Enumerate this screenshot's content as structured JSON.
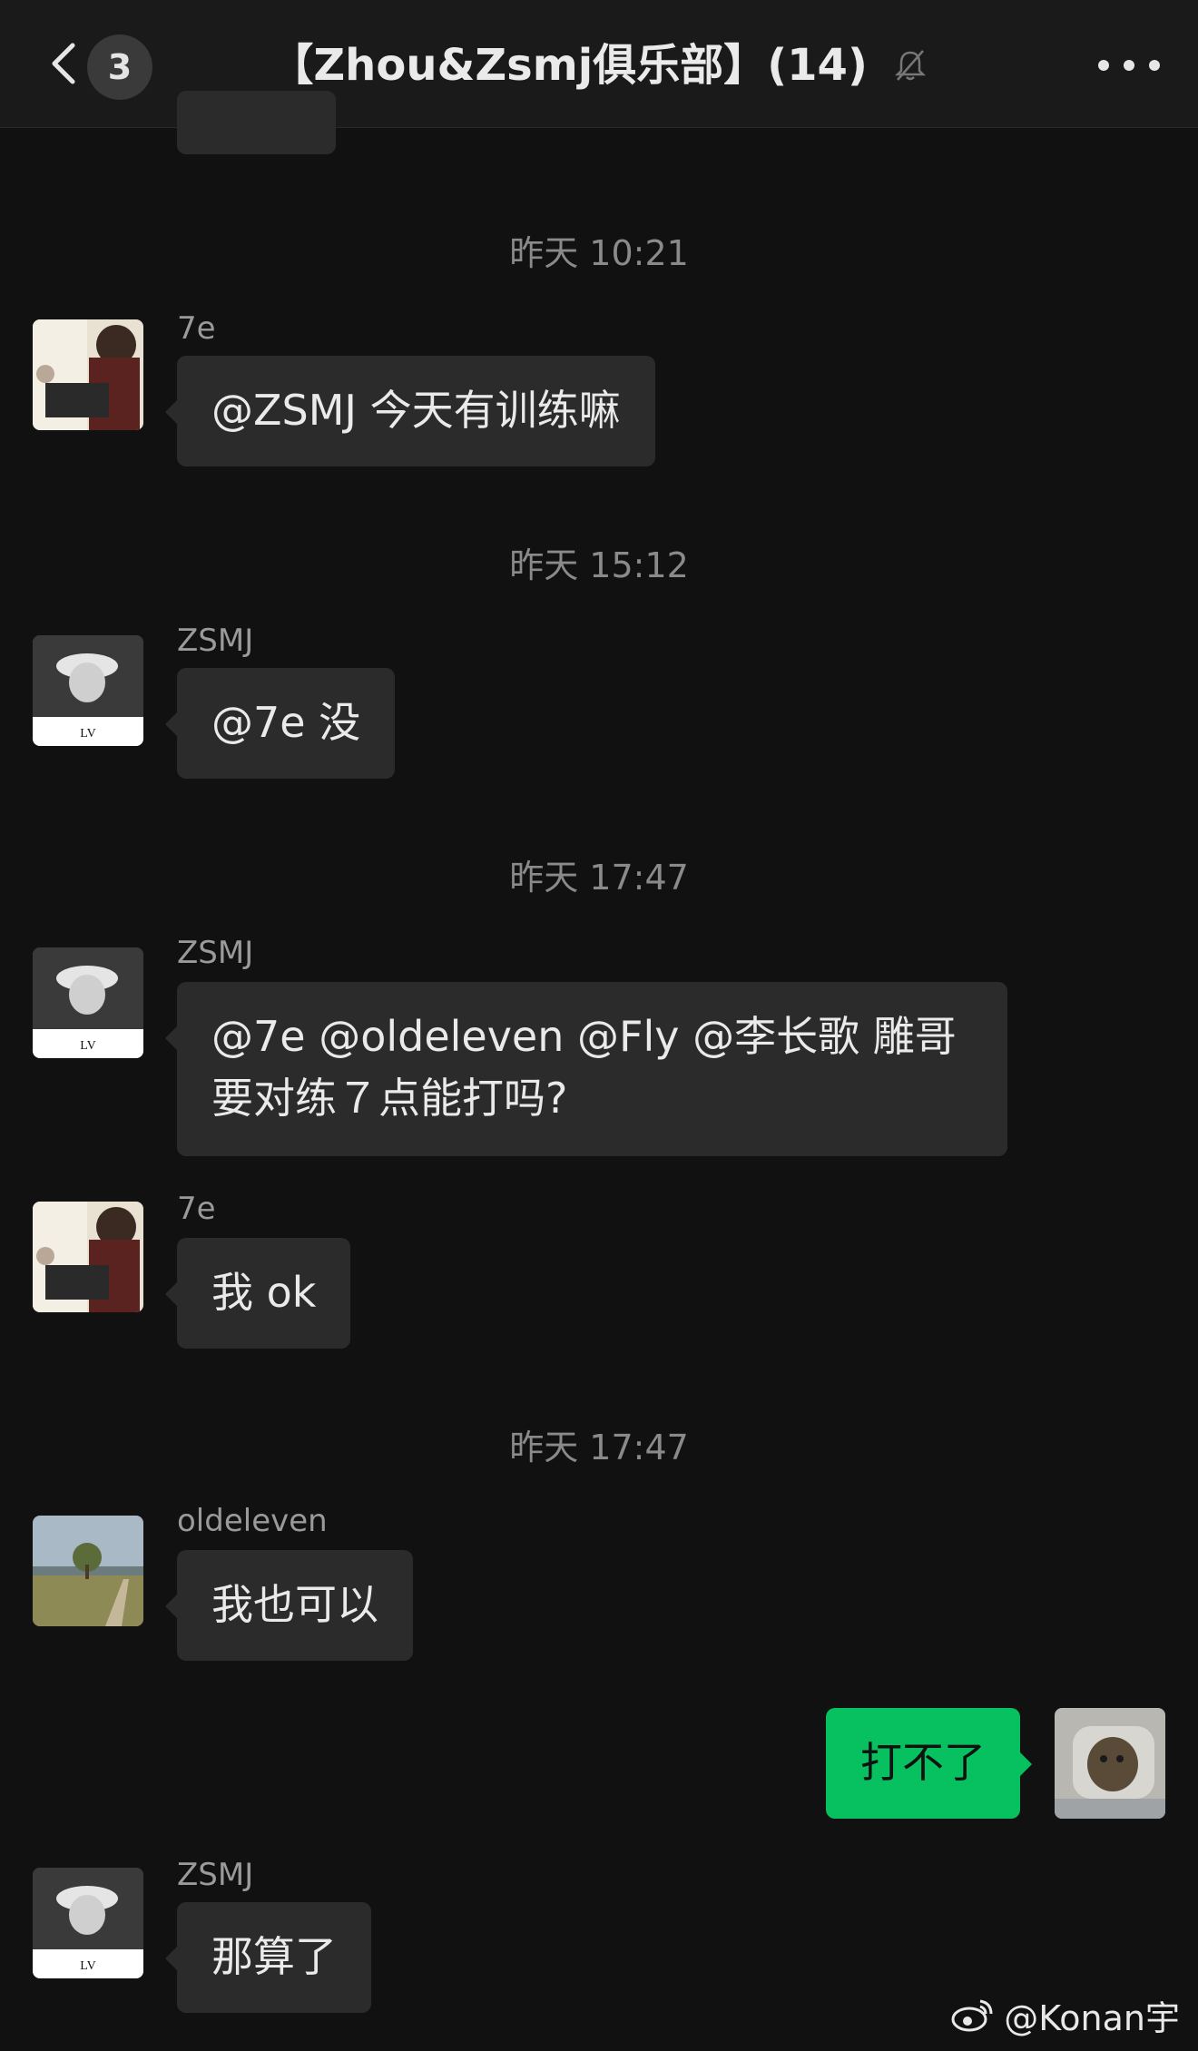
{
  "header": {
    "unread_count": "3",
    "title": "【Zhou&Zsmj俱乐部】(14)"
  },
  "messages": [
    {
      "type": "time",
      "text": "昨天 10:21"
    },
    {
      "type": "msg",
      "sender": "7e",
      "text": "@ZSMJ 今天有训练嘛"
    },
    {
      "type": "time",
      "text": "昨天 15:12"
    },
    {
      "type": "msg",
      "sender": "ZSMJ",
      "text": "@7e 没"
    },
    {
      "type": "time",
      "text": "昨天 17:47"
    },
    {
      "type": "msg",
      "sender": "ZSMJ",
      "text": "@7e @oldeleven @Fly @李长歌 雕哥要对练７点能打吗?"
    },
    {
      "type": "msg",
      "sender": "7e",
      "text": "我 ok"
    },
    {
      "type": "time",
      "text": "昨天 17:47"
    },
    {
      "type": "msg",
      "sender": "oldeleven",
      "text": "我也可以"
    },
    {
      "type": "msg",
      "sender": "me",
      "text": "打不了"
    },
    {
      "type": "msg",
      "sender": "ZSMJ",
      "text": "那算了"
    }
  ],
  "watermark": "@Konan宇",
  "colors": {
    "background": "#111111",
    "bubble_other": "#2b2b2b",
    "bubble_self": "#07c160"
  }
}
